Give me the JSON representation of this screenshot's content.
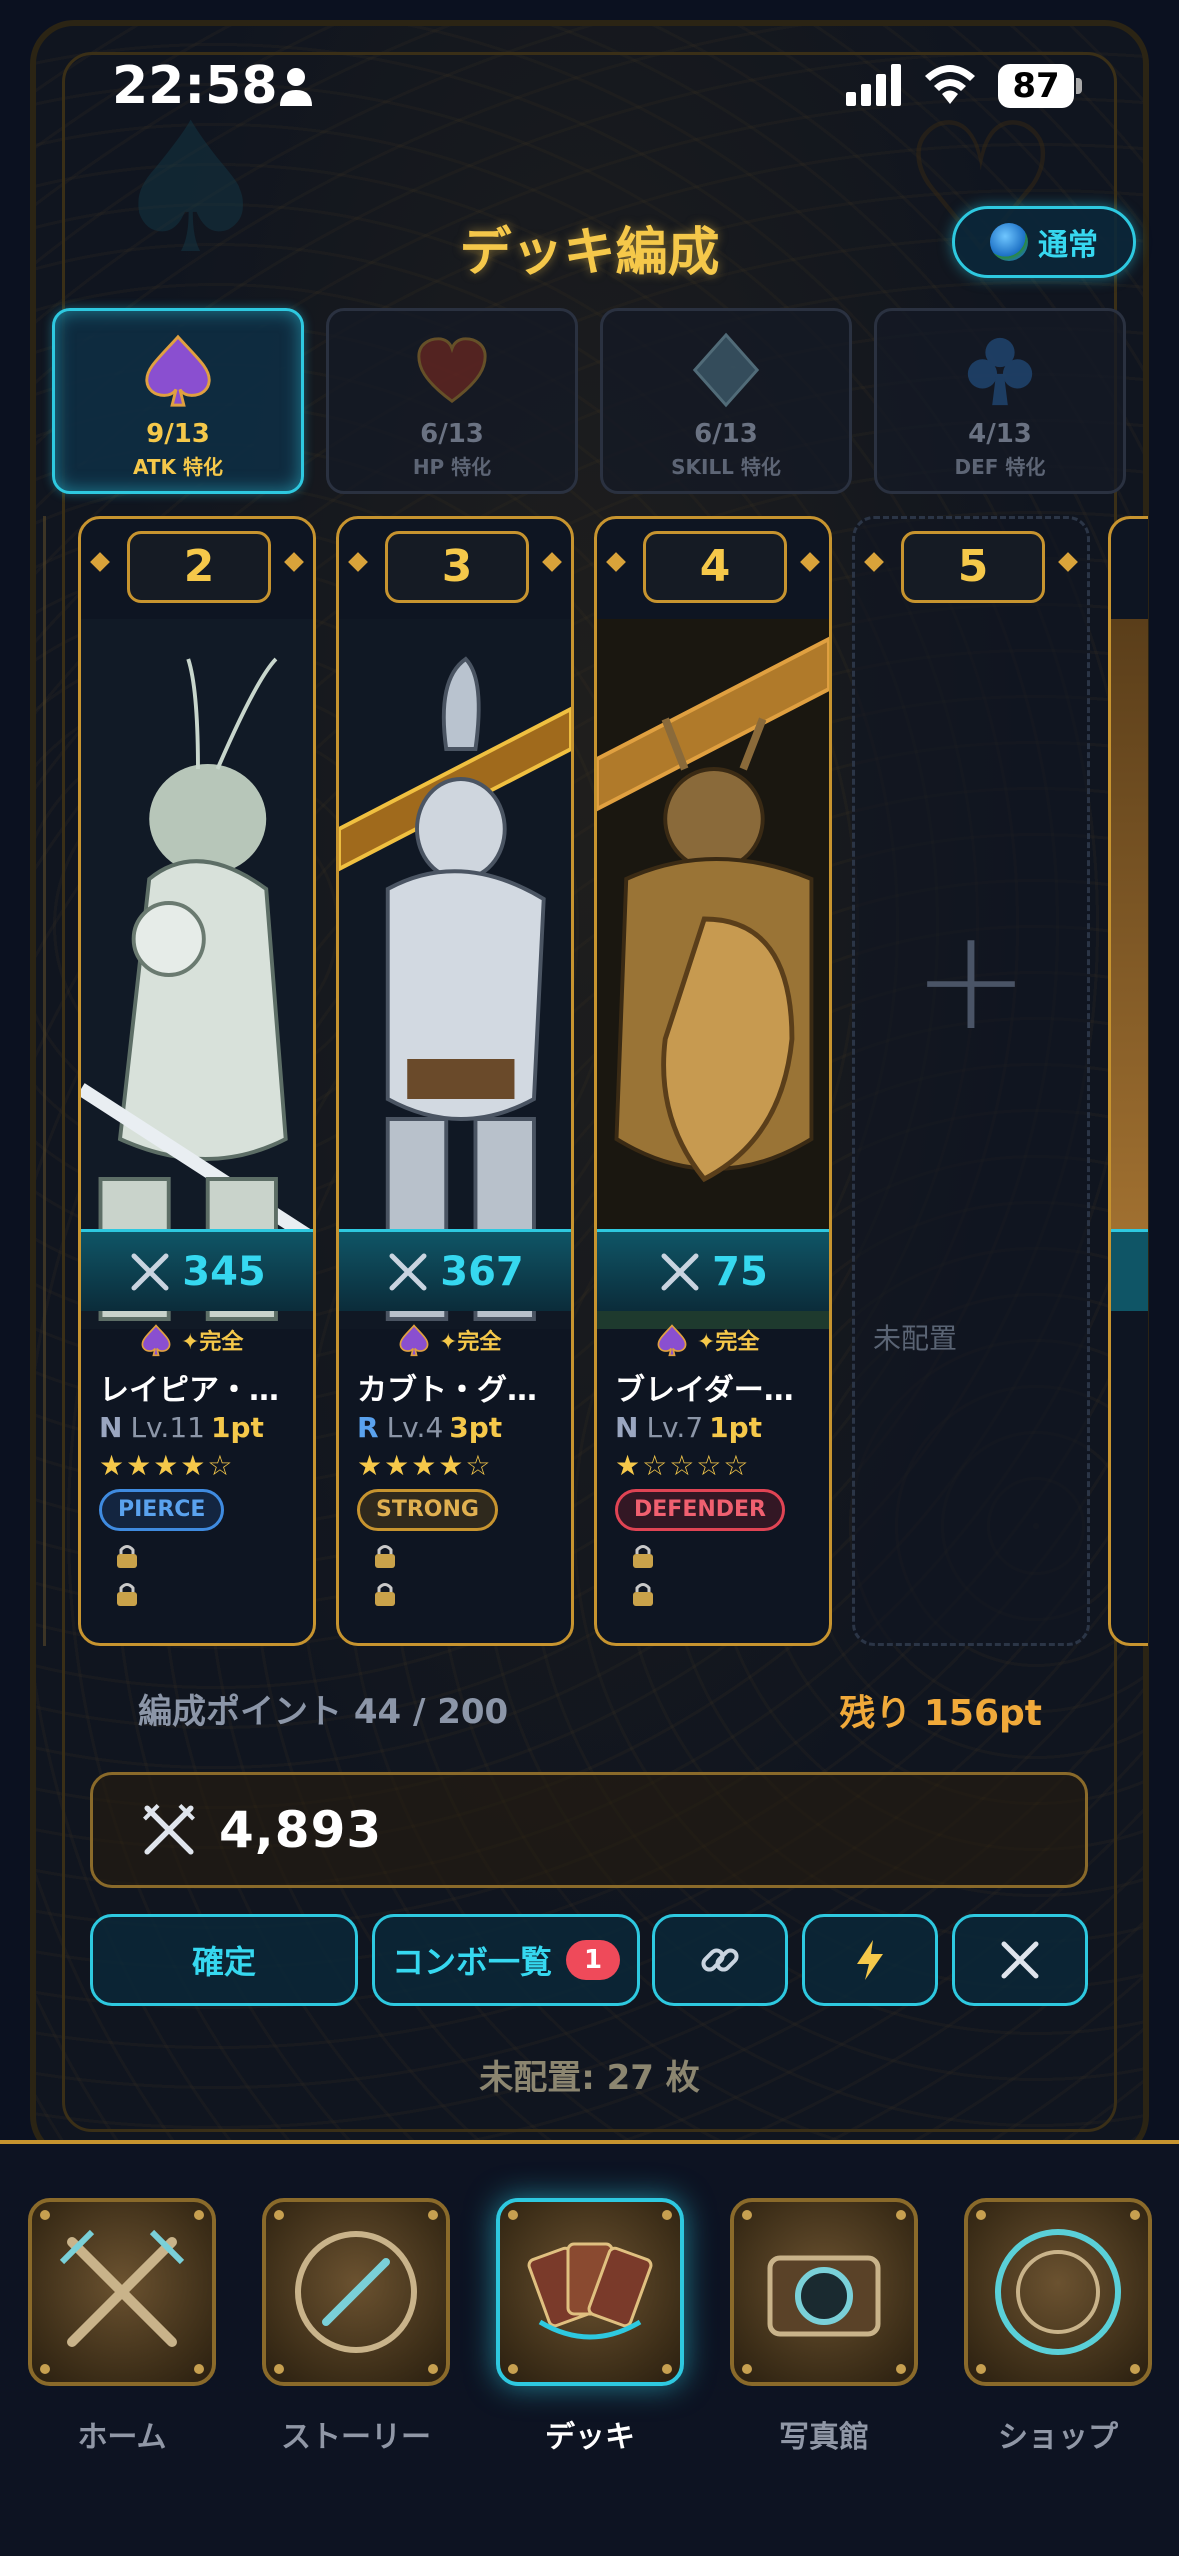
{
  "status_bar": {
    "time": "22:58",
    "battery": "87"
  },
  "header": {
    "title": "デッキ編成",
    "mode_label": "通常"
  },
  "tabs": [
    {
      "count": "9/13",
      "label": "ATK 特化",
      "icon": "spade-icon",
      "active": true
    },
    {
      "count": "6/13",
      "label": "HP 特化",
      "icon": "heart-icon",
      "active": false
    },
    {
      "count": "6/13",
      "label": "SKILL 特化",
      "icon": "diamond-icon",
      "active": false
    },
    {
      "count": "4/13",
      "label": "DEF 特化",
      "icon": "club-icon",
      "active": false
    }
  ],
  "cards": [
    {
      "slot": "2",
      "power": "345",
      "complete": "✦完全",
      "name": "レイピア・…",
      "rarity": "N",
      "level": "Lv.11",
      "points": "1pt",
      "stars": "★★★★☆",
      "type": "PIERCE",
      "type_color": "#3f8be0"
    },
    {
      "slot": "3",
      "power": "367",
      "complete": "✦完全",
      "name": "カブト・グ…",
      "rarity": "R",
      "level": "Lv.4",
      "points": "3pt",
      "stars": "★★★★☆",
      "type": "STRONG",
      "type_color": "#c7942f"
    },
    {
      "slot": "4",
      "power": "75",
      "complete": "✦完全",
      "name": "ブレイダー…",
      "rarity": "N",
      "level": "Lv.7",
      "points": "1pt",
      "stars": "★☆☆☆☆",
      "type": "DEFENDER",
      "type_color": "#e04454"
    }
  ],
  "empty_slot": {
    "slot": "5",
    "label": "未配置"
  },
  "points": {
    "label": "編成ポイント 44 / 200",
    "remaining": "残り 156pt"
  },
  "total_power": "4,893",
  "actions": {
    "confirm": "確定",
    "combo": "コンボ一覧",
    "combo_badge": "1"
  },
  "unplaced_count": "未配置: 27 枚",
  "nav": [
    {
      "label": "ホーム",
      "icon": "crossed-swords-icon",
      "active": false
    },
    {
      "label": "ストーリー",
      "icon": "compass-icon",
      "active": false
    },
    {
      "label": "デッキ",
      "icon": "cards-icon",
      "active": true
    },
    {
      "label": "写真館",
      "icon": "camera-icon",
      "active": false
    },
    {
      "label": "ショップ",
      "icon": "emblem-icon",
      "active": false
    }
  ],
  "colors": {
    "accent_cyan": "#2ec9e0",
    "gold": "#f5c84a",
    "frame_gold": "#c7942f",
    "background": "#0b1120"
  }
}
